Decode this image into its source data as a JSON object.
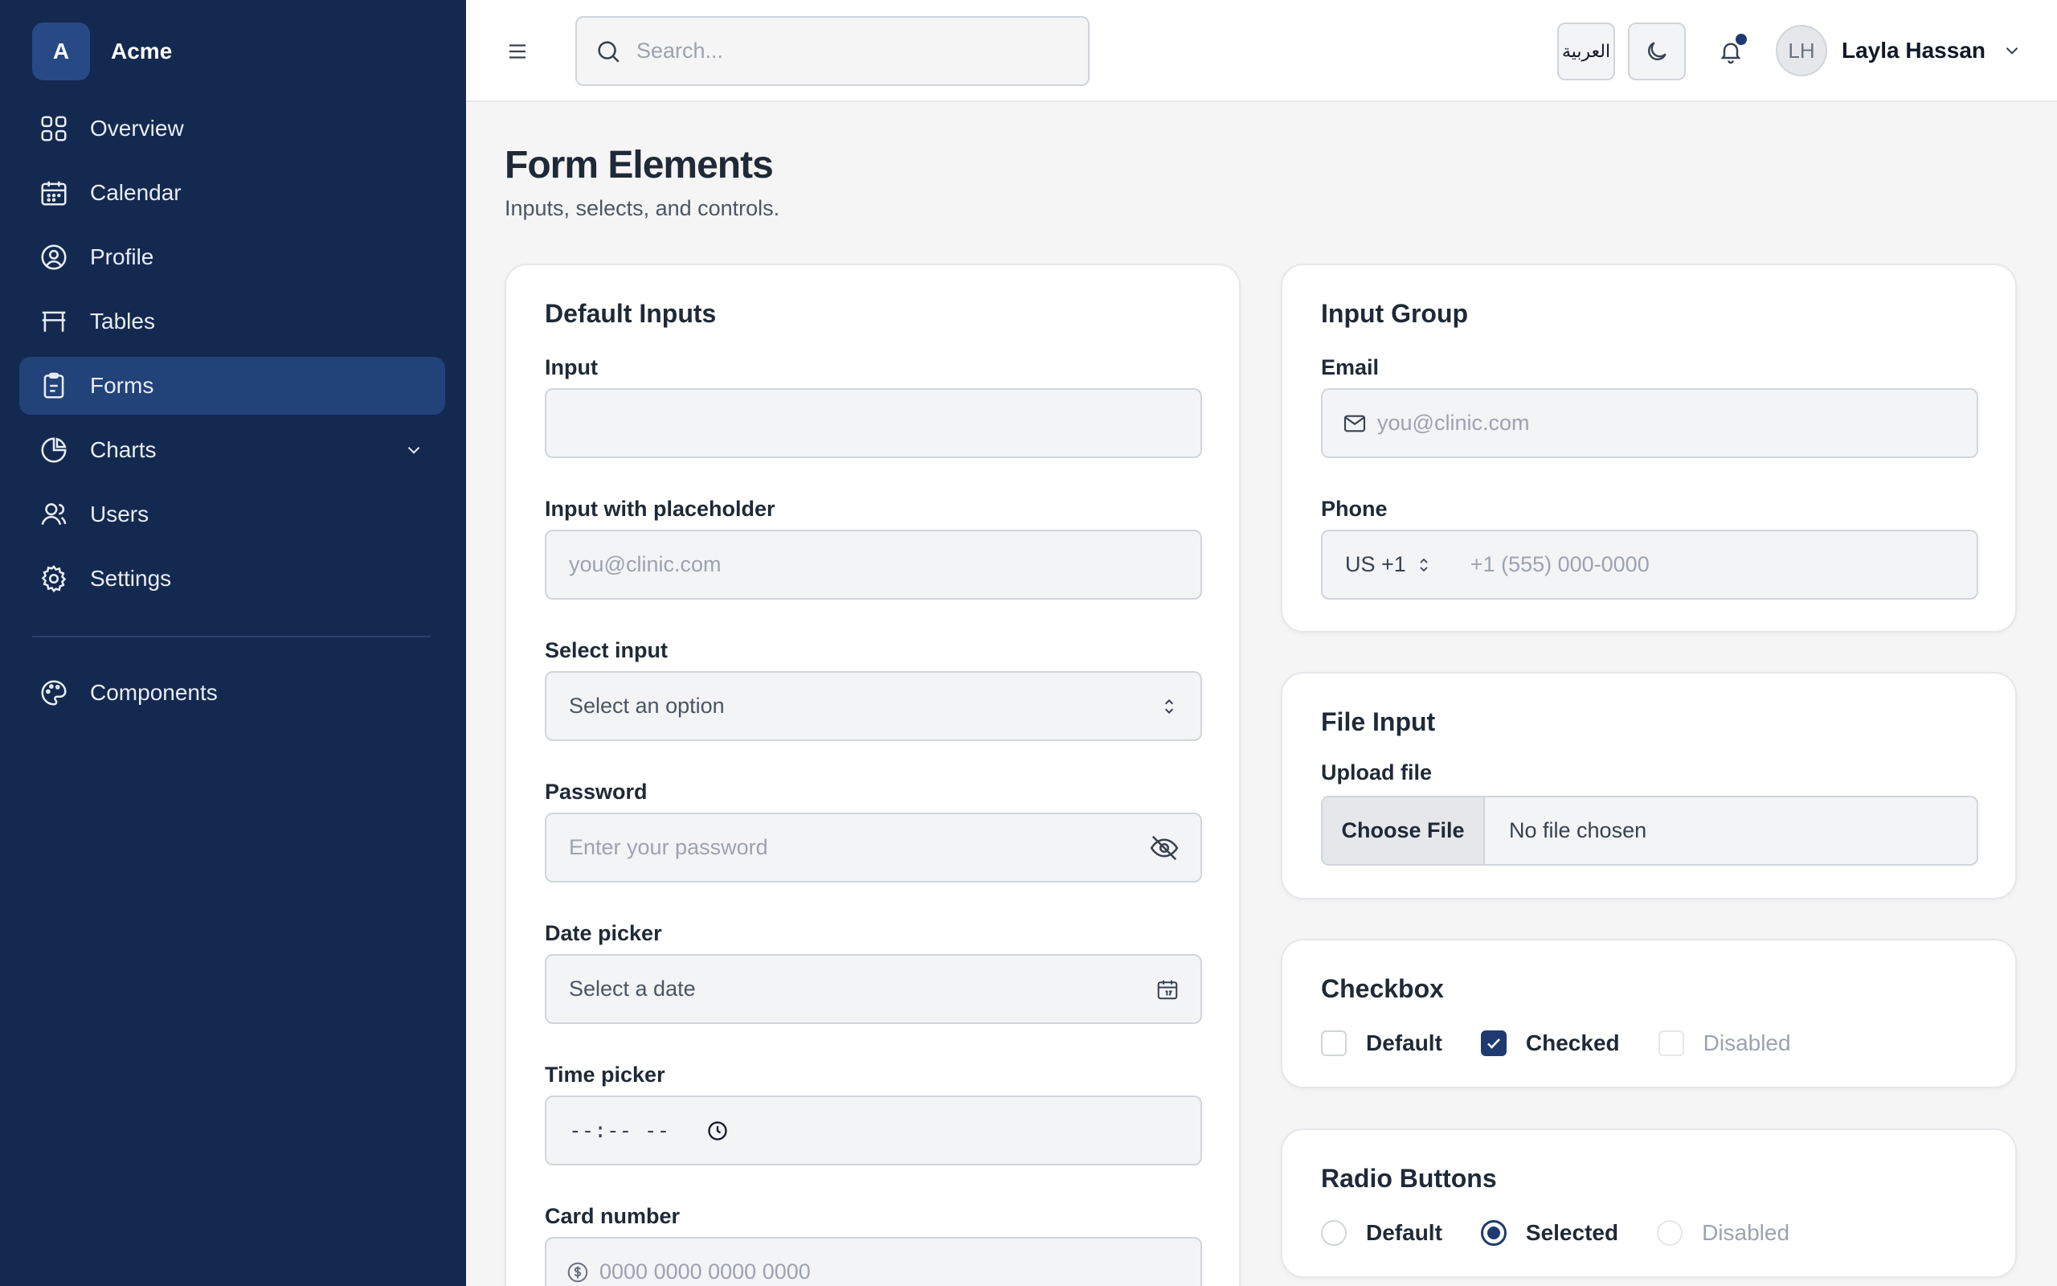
{
  "brand": {
    "logo_letter": "A",
    "name": "Acme"
  },
  "sidebar": {
    "items": [
      {
        "label": "Overview",
        "icon": "grid-icon"
      },
      {
        "label": "Calendar",
        "icon": "calendar-icon"
      },
      {
        "label": "Profile",
        "icon": "user-circle-icon"
      },
      {
        "label": "Tables",
        "icon": "table-icon"
      },
      {
        "label": "Forms",
        "icon": "clipboard-icon",
        "active": true
      },
      {
        "label": "Charts",
        "icon": "pie-chart-icon",
        "expandable": true
      },
      {
        "label": "Users",
        "icon": "users-icon"
      },
      {
        "label": "Settings",
        "icon": "gear-icon"
      }
    ],
    "components": {
      "label": "Components",
      "icon": "palette-icon"
    }
  },
  "topbar": {
    "search_placeholder": "Search...",
    "language_label": "العربية",
    "user_initials": "LH",
    "user_name": "Layla Hassan"
  },
  "page": {
    "title": "Form Elements",
    "subtitle": "Inputs, selects, and controls."
  },
  "default_inputs": {
    "title": "Default Inputs",
    "input_label": "Input",
    "input_value": "",
    "placeholder_label": "Input with placeholder",
    "placeholder_text": "you@clinic.com",
    "select_label": "Select input",
    "select_value": "Select an option",
    "password_label": "Password",
    "password_placeholder": "Enter your password",
    "date_label": "Date picker",
    "date_placeholder": "Select a date",
    "time_label": "Time picker",
    "time_placeholder": "--:-- --",
    "card_label": "Card number",
    "card_placeholder": "0000 0000 0000 0000"
  },
  "input_group": {
    "title": "Input Group",
    "email_label": "Email",
    "email_placeholder": "you@clinic.com",
    "phone_label": "Phone",
    "country_code": "US +1",
    "phone_placeholder": "+1 (555) 000-0000"
  },
  "file_input": {
    "title": "File Input",
    "label": "Upload file",
    "button_label": "Choose File",
    "status": "No file chosen"
  },
  "checkbox": {
    "title": "Checkbox",
    "options": [
      {
        "label": "Default",
        "state": "unchecked"
      },
      {
        "label": "Checked",
        "state": "checked"
      },
      {
        "label": "Disabled",
        "state": "disabled"
      }
    ]
  },
  "radio": {
    "title": "Radio Buttons",
    "options": [
      {
        "label": "Default",
        "state": "unselected"
      },
      {
        "label": "Selected",
        "state": "selected"
      },
      {
        "label": "Disabled",
        "state": "disabled"
      }
    ]
  },
  "colors": {
    "sidebar_bg": "#14294f",
    "sidebar_active": "#22427a",
    "accent": "#1e3a70",
    "page_bg": "#f5f5f5"
  }
}
